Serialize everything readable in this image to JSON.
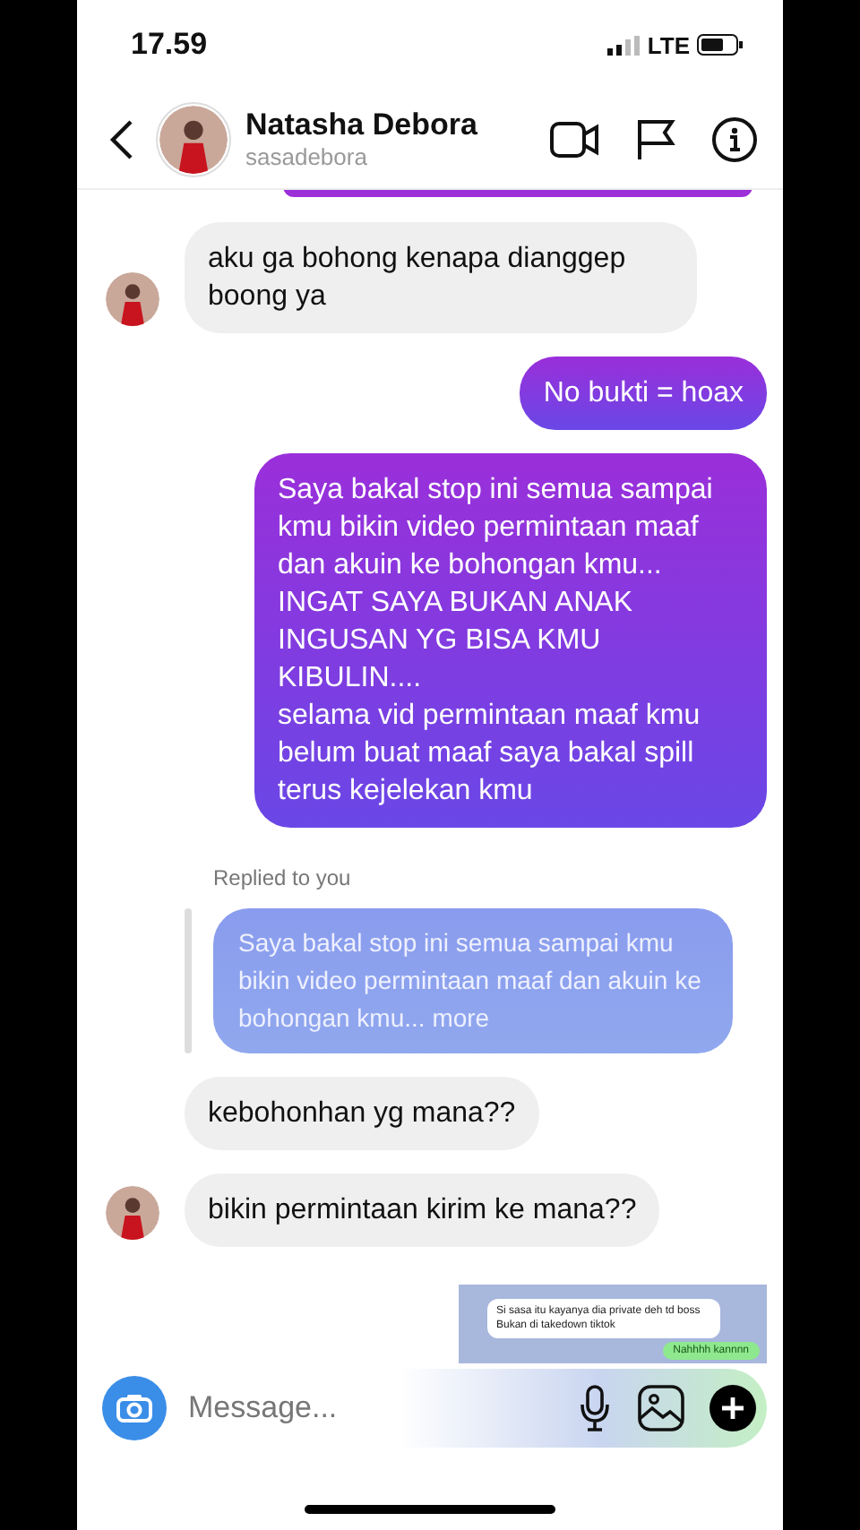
{
  "status_bar": {
    "time": "17.59",
    "network": "LTE"
  },
  "header": {
    "name": "Natasha Debora",
    "username": "sasadebora"
  },
  "messages": [
    {
      "kind": "edge"
    },
    {
      "kind": "received",
      "avatar": true,
      "text": "aku ga bohong kenapa dianggep boong ya"
    },
    {
      "kind": "sent",
      "text": "No bukti = hoax"
    },
    {
      "kind": "sent",
      "text": "Saya bakal stop ini semua sampai kmu bikin video permintaan maaf dan akuin ke bohongan kmu...\nINGAT SAYA BUKAN ANAK INGUSAN YG BISA KMU KIBULIN....\nselama vid permintaan maaf kmu belum buat maaf saya bakal spill terus kejelekan kmu"
    },
    {
      "kind": "reply",
      "label": "Replied to you",
      "quote": "Saya bakal stop ini semua sampai kmu bikin video permintaan maaf dan akuin ke bohongan kmu...",
      "more": "more"
    },
    {
      "kind": "received",
      "avatar": false,
      "text": "kebohonhan yg mana??"
    },
    {
      "kind": "received",
      "avatar": true,
      "text": "bikin permintaan kirim ke mana??"
    },
    {
      "kind": "image",
      "lines": [
        "Si sasa itu kayanya dia private deh td boss",
        "Bukan di takedown tiktok"
      ],
      "answer": "Nahhhh kannnn"
    }
  ],
  "composer": {
    "placeholder": "Message..."
  }
}
